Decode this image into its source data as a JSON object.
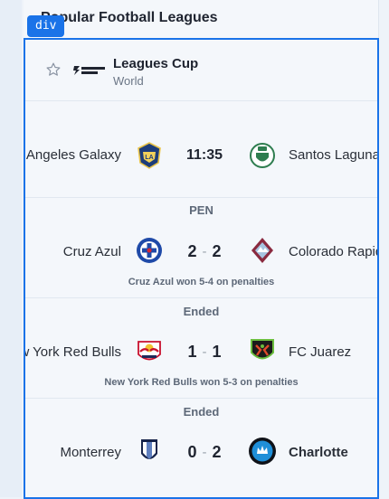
{
  "section": {
    "title": "Popular Football Leagues"
  },
  "dev_overlay": {
    "tag": "div"
  },
  "league": {
    "name": "Leagues Cup",
    "country": "World",
    "logo_text": "LEAGUES CUP",
    "favorite_icon": "star-outline-icon"
  },
  "matches": [
    {
      "status": "",
      "home": "Los Angeles Galaxy",
      "away": "Santos Laguna",
      "time": "11:35",
      "home_score": "",
      "away_score": "",
      "note": "",
      "home_crest": "la-galaxy-crest",
      "away_crest": "santos-laguna-crest"
    },
    {
      "status": "PEN",
      "home": "Cruz Azul",
      "away": "Colorado Rapids",
      "time": "",
      "home_score": "2",
      "away_score": "2",
      "note": "Cruz Azul won 5-4 on penalties",
      "home_crest": "cruz-azul-crest",
      "away_crest": "colorado-rapids-crest"
    },
    {
      "status": "Ended",
      "home": "New York Red Bulls",
      "away": "FC Juarez",
      "time": "",
      "home_score": "1",
      "away_score": "1",
      "note": "New York Red Bulls won 5-3 on penalties",
      "home_crest": "red-bulls-crest",
      "away_crest": "fc-juarez-crest"
    },
    {
      "status": "Ended",
      "home": "Monterrey",
      "away": "Charlotte",
      "time": "",
      "home_score": "0",
      "away_score": "2",
      "note": "",
      "winner": "away",
      "home_crest": "monterrey-crest",
      "away_crest": "charlotte-crest"
    }
  ],
  "colors": {
    "accent": "#1a73e8",
    "text": "#1f2430",
    "muted": "#5d6878",
    "background": "#f4f7fb"
  }
}
